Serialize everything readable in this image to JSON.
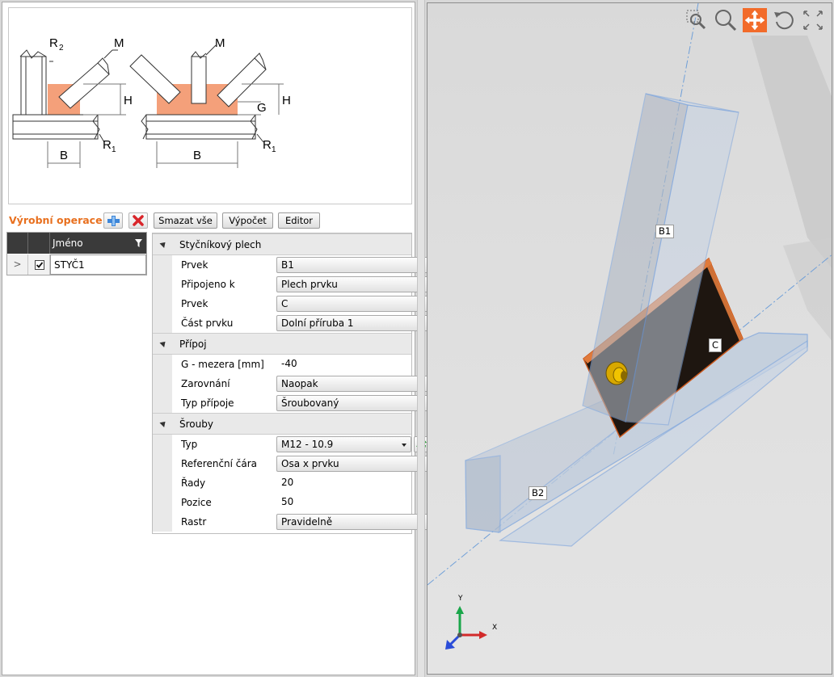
{
  "sketch": {
    "labels": {
      "r2": "R",
      "r2_sub": "2",
      "m_left": "M",
      "m_right": "M",
      "h_left": "H",
      "h_right": "H",
      "g": "G",
      "r1_left": "R",
      "r1_left_sub": "1",
      "r1_right": "R",
      "r1_right_sub": "1",
      "b_left": "B",
      "b_right": "B"
    }
  },
  "toolbar": {
    "title": "Výrobní operace",
    "add_icon": "plus-icon",
    "delete_icon": "delete-x-icon",
    "delete_all": "Smazat vše",
    "calculate": "Výpočet",
    "editor": "Editor"
  },
  "grid": {
    "header_name": "Jméno",
    "filter_icon": "filter-icon",
    "row": {
      "expander": ">",
      "checked": true,
      "name": "STYČ1"
    }
  },
  "properties": {
    "sections": [
      {
        "title": "Styčníkový plech",
        "rows": [
          {
            "label": "Prvek",
            "value": "B1",
            "type": "combo"
          },
          {
            "label": "Připojeno k",
            "value": "Plech prvku",
            "type": "combo"
          },
          {
            "label": "Prvek",
            "value": "C",
            "type": "combo"
          },
          {
            "label": "Část prvku",
            "value": "Dolní příruba 1",
            "type": "combo"
          }
        ]
      },
      {
        "title": "Přípoj",
        "rows": [
          {
            "label": "G - mezera [mm]",
            "value": "-40",
            "type": "text"
          },
          {
            "label": "Zarovnání",
            "value": "Naopak",
            "type": "combo"
          },
          {
            "label": "Typ přípoje",
            "value": "Šroubovaný",
            "type": "combo"
          }
        ]
      },
      {
        "title": "Šrouby",
        "rows": [
          {
            "label": "Typ",
            "value": "M12 - 10.9",
            "type": "combo-refresh"
          },
          {
            "label": "Referenční čára",
            "value": "Osa x prvku",
            "type": "combo"
          },
          {
            "label": "Řady",
            "value": "20",
            "type": "text"
          },
          {
            "label": "Pozice",
            "value": "50",
            "type": "text"
          },
          {
            "label": "Rastr",
            "value": "Pravidelně",
            "type": "combo"
          }
        ]
      }
    ]
  },
  "view": {
    "tools": [
      "zoom-window-icon",
      "zoom-icon",
      "pan-icon",
      "rotate-icon",
      "fit-view-icon"
    ],
    "active_tool": "pan-icon",
    "accent": "#f26b2a",
    "member_labels": {
      "b1": "B1",
      "b2": "B2",
      "c": "C"
    },
    "axes": {
      "x": "X",
      "y": "Y"
    }
  }
}
